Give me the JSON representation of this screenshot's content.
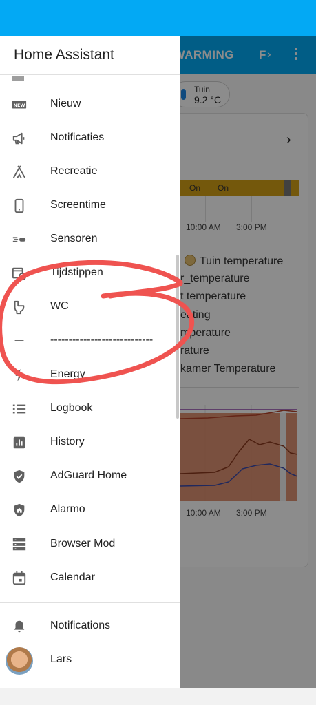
{
  "app": {
    "title": "Home Assistant"
  },
  "background": {
    "tabs": [
      "RWARMING",
      "F"
    ],
    "badge": {
      "label": "Tuin",
      "value": "9.2 °C"
    },
    "timeline": {
      "states": [
        "On",
        "On"
      ]
    },
    "axis": {
      "time1": "10:00 AM",
      "time2": "3:00 PM"
    },
    "legend": [
      "Tuin temperature",
      "r_temperature",
      "t temperature",
      "eating",
      "mperature",
      "rature",
      "kamer Temperature"
    ]
  },
  "sidebar": {
    "items": [
      {
        "label": "Nieuw",
        "icon": "new-box-icon"
      },
      {
        "label": "Notificaties",
        "icon": "bullhorn-icon"
      },
      {
        "label": "Recreatie",
        "icon": "tent-icon"
      },
      {
        "label": "Screentime",
        "icon": "cellphone-icon"
      },
      {
        "label": "Sensoren",
        "icon": "sensor-icon"
      },
      {
        "label": "Tijdstippen",
        "icon": "calendar-clock-icon"
      },
      {
        "label": "WC",
        "icon": "toilet-icon"
      },
      {
        "label": "----------------------------",
        "icon": "minus-icon"
      },
      {
        "label": "Energy",
        "icon": "lightning-icon"
      },
      {
        "label": "Logbook",
        "icon": "format-list-bulleted-icon"
      },
      {
        "label": "History",
        "icon": "chart-box-icon"
      },
      {
        "label": "AdGuard Home",
        "icon": "shield-check-icon"
      },
      {
        "label": "Alarmo",
        "icon": "shield-home-icon"
      },
      {
        "label": "Browser Mod",
        "icon": "server-icon"
      },
      {
        "label": "Calendar",
        "icon": "calendar-icon"
      }
    ],
    "notifications": "Notifications",
    "user": "Lars"
  },
  "colors": {
    "accent": "#03a9f4",
    "annotation": "#ef5350",
    "timeline": "#d4a017",
    "chart_fill": "#d9805a"
  }
}
